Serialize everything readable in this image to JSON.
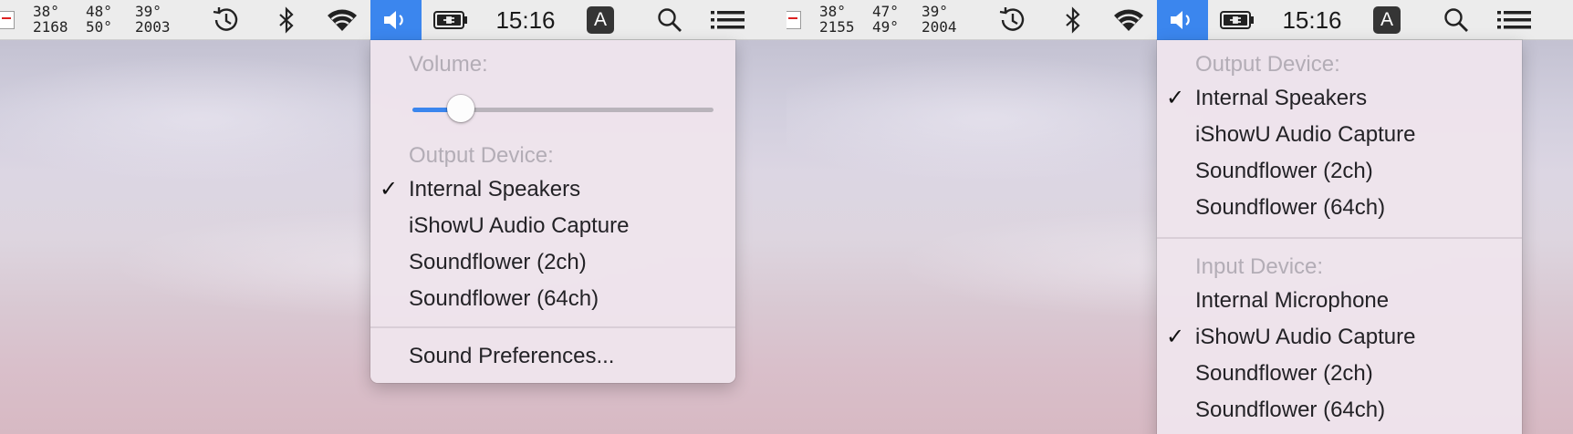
{
  "screens": [
    {
      "menubar": {
        "temps": {
          "col1_top": "38°",
          "col1_bottom": "2168",
          "col2_top": "48°",
          "col2_bottom": "50°",
          "col3_top": "39°",
          "col3_bottom": "2003"
        },
        "clock": "15:16",
        "input_source": "A"
      },
      "menu": {
        "volume_header": "Volume:",
        "volume_level": 0.16,
        "output_header": "Output Device:",
        "output_devices": [
          {
            "label": "Internal Speakers",
            "checked": true
          },
          {
            "label": "iShowU Audio Capture",
            "checked": false
          },
          {
            "label": "Soundflower (2ch)",
            "checked": false
          },
          {
            "label": "Soundflower (64ch)",
            "checked": false
          }
        ],
        "preferences": "Sound Preferences..."
      }
    },
    {
      "menubar": {
        "temps": {
          "col1_top": "38°",
          "col1_bottom": "2155",
          "col2_top": "47°",
          "col2_bottom": "49°",
          "col3_top": "39°",
          "col3_bottom": "2004"
        },
        "clock": "15:16",
        "input_source": "A"
      },
      "menu": {
        "output_header": "Output Device:",
        "output_devices": [
          {
            "label": "Internal Speakers",
            "checked": true
          },
          {
            "label": "iShowU Audio Capture",
            "checked": false
          },
          {
            "label": "Soundflower (2ch)",
            "checked": false
          },
          {
            "label": "Soundflower (64ch)",
            "checked": false
          }
        ],
        "input_header": "Input Device:",
        "input_devices": [
          {
            "label": "Internal Microphone",
            "checked": false
          },
          {
            "label": "iShowU Audio Capture",
            "checked": true
          },
          {
            "label": "Soundflower (2ch)",
            "checked": false
          },
          {
            "label": "Soundflower (64ch)",
            "checked": false
          }
        ]
      }
    }
  ],
  "checkmark": "✓",
  "colors": {
    "accent": "#3b86ee",
    "menubar": "#ececec",
    "menu_bg": "#eee4ec",
    "header_text": "#b3adb6"
  },
  "icons": [
    "time-machine-icon",
    "bluetooth-icon",
    "wifi-icon",
    "speaker-icon",
    "battery-plug-icon",
    "search-icon",
    "notification-list-icon"
  ]
}
